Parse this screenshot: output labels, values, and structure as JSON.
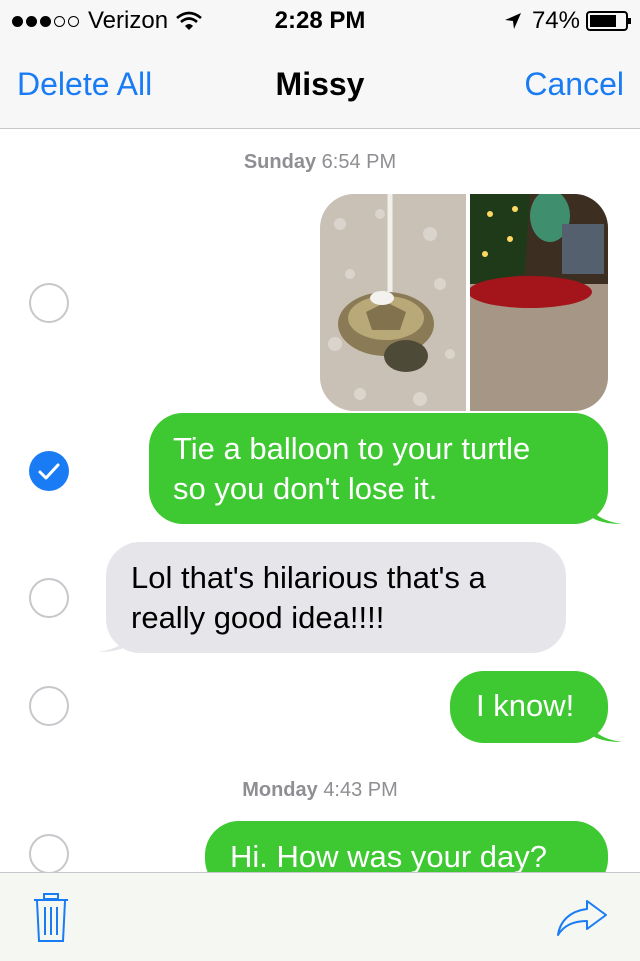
{
  "status_bar": {
    "carrier": "Verizon",
    "time": "2:28 PM",
    "battery": "74%",
    "signal_bars": 3
  },
  "nav": {
    "left_button": "Delete All",
    "title": "Missy",
    "right_button": "Cancel"
  },
  "timestamps": [
    {
      "day": "Sunday",
      "time": "6:54 PM"
    },
    {
      "day": "Monday",
      "time": "4:43 PM"
    }
  ],
  "messages": [
    {
      "direction": "outgoing",
      "type": "image",
      "selected": false
    },
    {
      "direction": "outgoing",
      "lines": [
        "Tie a balloon to your turtle",
        "so you don't lose it."
      ],
      "selected": true
    },
    {
      "direction": "incoming",
      "lines": [
        "Lol that's hilarious that's a",
        "really good idea!!!!"
      ],
      "selected": false
    },
    {
      "direction": "outgoing",
      "lines": [
        "I know!"
      ],
      "selected": false
    },
    {
      "direction": "outgoing",
      "lines": [
        "Hi. How was your day?"
      ],
      "selected": false
    }
  ],
  "colors": {
    "accent": "#1a7cf5",
    "outgoing_bubble": "#3ec832",
    "incoming_bubble": "#e5e5ea",
    "timestamp": "#8e8e93"
  },
  "toolbar": {
    "left_icon": "trash-icon",
    "right_icon": "forward-icon"
  }
}
